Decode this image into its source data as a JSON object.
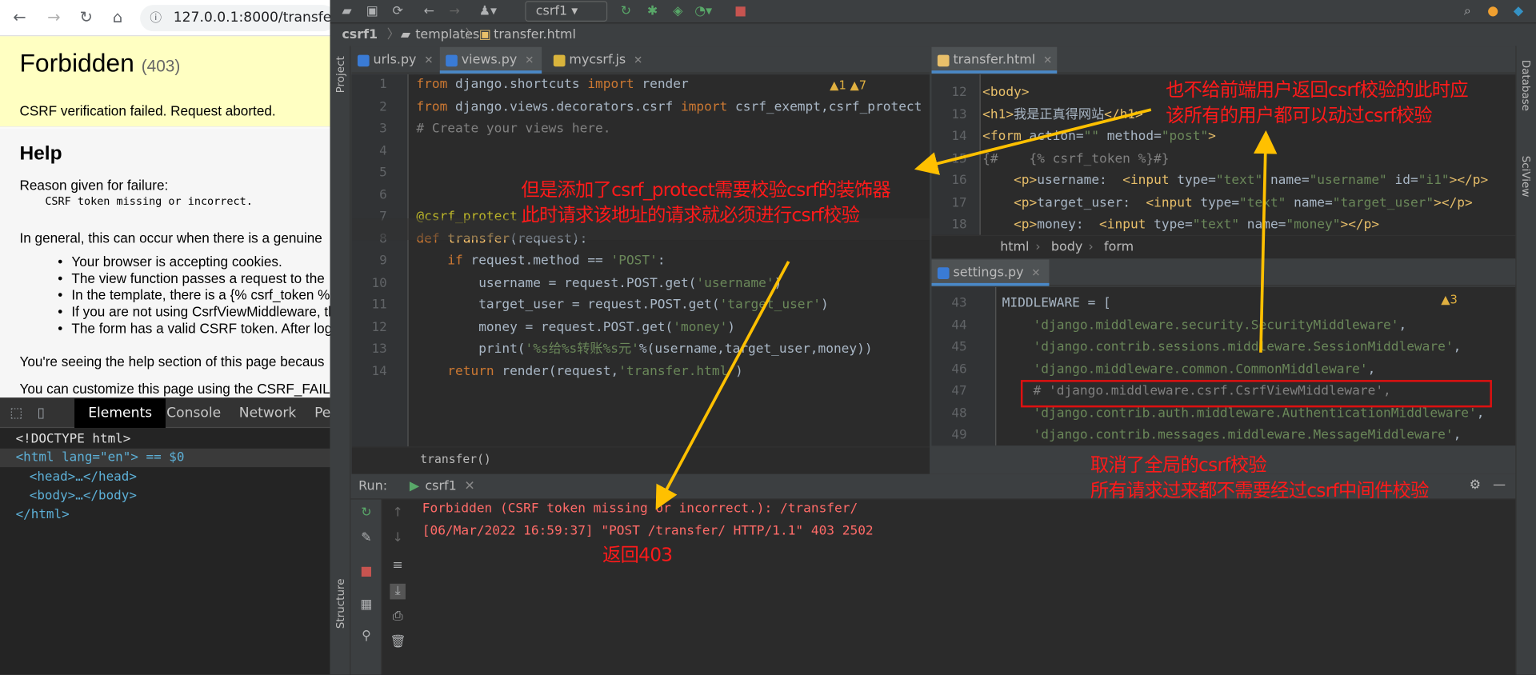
{
  "browser": {
    "url": "127.0.0.1:8000/transfer/",
    "title": "Forbidden",
    "code": "(403)",
    "message": "CSRF verification failed. Request aborted.",
    "help_heading": "Help",
    "reason_label": "Reason given for failure:",
    "reason": "CSRF token missing or incorrect.",
    "general": "In general, this can occur when there is a genuine",
    "bullets": [
      "Your browser is accepting cookies.",
      "The view function passes a request to the",
      "In the template, there is a {% csrf_token %",
      "If you are not using CsrfViewMiddleware, th",
      "The form has a valid CSRF token. After log"
    ],
    "seeing": "You're seeing the help section of this page becaus",
    "customize": "You can customize this page using the CSRF_FAILU"
  },
  "devtools": {
    "tabs": [
      "Elements",
      "Console",
      "Network",
      "Pe"
    ],
    "lines": [
      "<!DOCTYPE html>",
      "<html lang=\"en\"> == $0",
      "<head>…</head>",
      "<body>…</body>",
      "</html>"
    ]
  },
  "ide": {
    "run_config": "csrf1",
    "breadcrumb": [
      "csrf1",
      "templates",
      "transfer.html"
    ],
    "project_label": "Project",
    "structure_label": "Structure",
    "right_tools": [
      "Database",
      "SciView"
    ],
    "left_tabs": [
      "urls.py",
      "views.py",
      "mycsrf.js"
    ],
    "views_code": {
      "line_numbers": [
        "1",
        "2",
        "3",
        "4",
        "5",
        "6",
        "7",
        "8",
        "9",
        "10",
        "11",
        "12",
        "13",
        "14"
      ],
      "lines": [
        "from django.shortcuts import render",
        "from django.views.decorators.csrf import csrf_exempt,csrf_protect",
        "# Create your views here.",
        "",
        "",
        "",
        "@csrf_protect",
        "def transfer(request):",
        "    if request.method == 'POST':",
        "        username = request.POST.get('username')",
        "        target_user = request.POST.get('target_user')",
        "        money = request.POST.get('money')",
        "        print('%s给%s转账%s元'%(username,target_user,money))",
        "    return render(request,'transfer.html')"
      ],
      "inspection": "▲1  ▲7",
      "footer": "transfer()"
    },
    "html_tab": "transfer.html",
    "html_code": {
      "line_numbers": [
        "12",
        "13",
        "14",
        "15",
        "16",
        "17",
        "18"
      ],
      "lines": [
        "<body>",
        "<h1>我是正真得网站</h1>",
        "<form action=\"\" method=\"post\">",
        "{#    {% csrf_token %}#}",
        "    <p>username:  <input type=\"text\" name=\"username\" id=\"i1\"></p>",
        "    <p>target_user:  <input type=\"text\" name=\"target_user\"></p>",
        "    <p>money:  <input type=\"text\" name=\"money\"></p>"
      ],
      "breadcrumb": [
        "html",
        "body",
        "form"
      ]
    },
    "settings_tab": "settings.py",
    "settings_code": {
      "line_numbers": [
        "43",
        "44",
        "45",
        "46",
        "47",
        "48",
        "49"
      ],
      "lines": [
        "MIDDLEWARE = [",
        "    'django.middleware.security.SecurityMiddleware',",
        "    'django.contrib.sessions.middleware.SessionMiddleware',",
        "    'django.middleware.common.CommonMiddleware',",
        "    # 'django.middleware.csrf.CsrfViewMiddleware',",
        "    'django.contrib.auth.middleware.AuthenticationMiddleware',",
        "    'django.contrib.messages.middleware.MessageMiddleware',"
      ],
      "inspection": "▲3"
    },
    "run": {
      "label": "Run:",
      "tab": "csrf1",
      "output": [
        "Forbidden (CSRF token missing or incorrect.): /transfer/",
        "[06/Mar/2022 16:59:37] \"POST /transfer/ HTTP/1.1\" 403 2502"
      ]
    }
  },
  "annotations": {
    "top_right": [
      "也不给前端用户返回csrf校验的此时应",
      "该所有的用户都可以动过csrf校验"
    ],
    "middle": [
      "但是添加了csrf_protect需要校验csrf的装饰器",
      "此时请求该地址的请求就必须进行csrf校验"
    ],
    "bottom_right": [
      "取消了全局的csrf校验",
      "所有请求过来都不需要经过csrf中间件校验"
    ],
    "returns": "返回403"
  },
  "colors": {
    "annotation": "#ff1a1a",
    "arrow": "#ffc000",
    "box": "#e01010"
  }
}
